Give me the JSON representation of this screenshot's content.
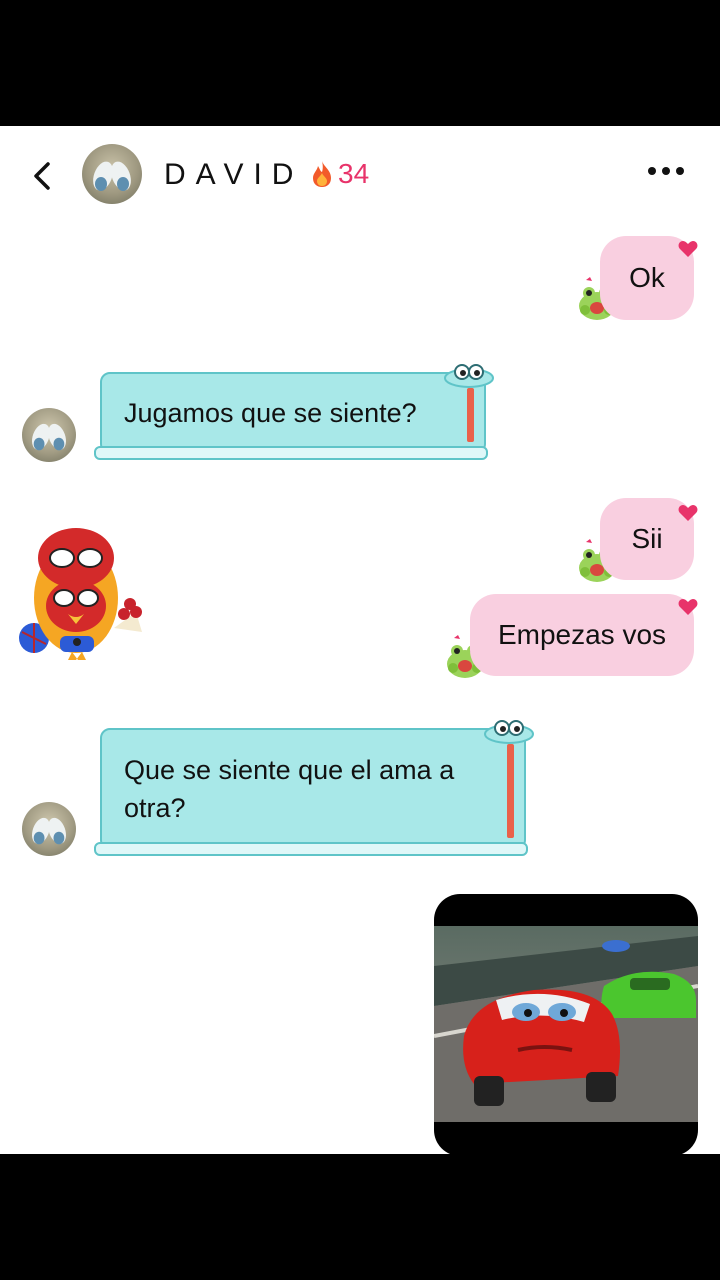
{
  "header": {
    "contact_name": "DAVID",
    "streak_count": "34",
    "back_icon": "chevron-left-icon",
    "more_icon": "more-horizontal-icon",
    "streak_icon": "fire-icon"
  },
  "messages": [
    {
      "side": "out",
      "text": "Ok"
    },
    {
      "side": "in",
      "text": "Jugamos que se siente?"
    },
    {
      "side": "in",
      "type": "sticker",
      "sticker": "spiderman-bird-sticker"
    },
    {
      "side": "out",
      "text": "Sii"
    },
    {
      "side": "out",
      "text": "Empezas vos"
    },
    {
      "side": "in",
      "text": "Que se siente que el ama a otra?"
    },
    {
      "side": "out",
      "type": "image",
      "image": "race-car-video-thumbnail"
    }
  ],
  "colors": {
    "outgoing_bubble": "#f9cfe0",
    "incoming_bubble": "#a8e8e8",
    "streak": "#e8336a"
  }
}
